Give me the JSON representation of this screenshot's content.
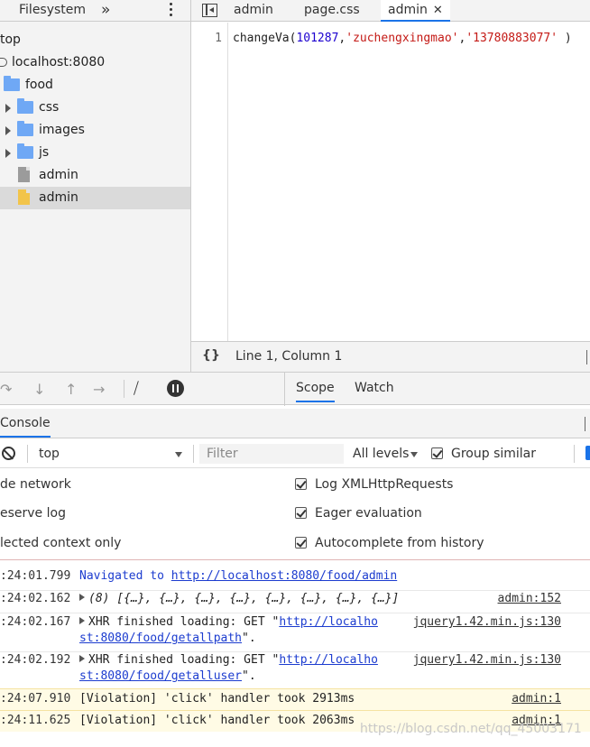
{
  "sidebar": {
    "tab_label": "Filesystem",
    "more_glyph": "»",
    "tree": [
      {
        "label": "top",
        "kind": "frame"
      },
      {
        "label": "localhost:8080",
        "kind": "origin"
      },
      {
        "label": "food",
        "kind": "folder"
      },
      {
        "label": "css",
        "kind": "folder"
      },
      {
        "label": "images",
        "kind": "folder"
      },
      {
        "label": "js",
        "kind": "folder"
      },
      {
        "label": "admin",
        "kind": "file-gray"
      },
      {
        "label": "admin",
        "kind": "file-yellow",
        "selected": true
      }
    ]
  },
  "editor": {
    "tabs": [
      {
        "label": "admin"
      },
      {
        "label": "page.css"
      },
      {
        "label": "admin",
        "active": true,
        "close": "✕"
      }
    ],
    "line_number": "1",
    "code": {
      "fn": "changeVa(",
      "num": "101287",
      "comma1": ",",
      "str1": "'zuchengxingmao'",
      "comma2": ",",
      "str2": "'13780883077'",
      "tail": " )"
    },
    "status": {
      "braces": "{}",
      "position": "Line 1, Column 1"
    }
  },
  "debugger": {
    "panel_tabs": [
      {
        "label": "Scope",
        "active": true
      },
      {
        "label": "Watch"
      }
    ]
  },
  "console": {
    "tab_label": "Console",
    "toolbar": {
      "context": "top",
      "filter_placeholder": "Filter",
      "levels": "All levels",
      "group_similar": "Group similar"
    },
    "settings": [
      {
        "label": "de network",
        "checked": false
      },
      {
        "label": "Log XMLHttpRequests",
        "checked": true
      },
      {
        "label": "eserve log",
        "checked": false
      },
      {
        "label": "Eager evaluation",
        "checked": true
      },
      {
        "label": "lected context only",
        "checked": false
      },
      {
        "label": "Autocomplete from history",
        "checked": true
      }
    ],
    "messages": [
      {
        "time": ":24:01.799",
        "text_prefix": "Navigated to ",
        "url": "http://localhost:8080/food/admin"
      },
      {
        "time": ":24:02.162",
        "text": "(8) [{…}, {…}, {…}, {…}, {…}, {…}, {…}, {…}]",
        "source": "admin:152"
      },
      {
        "time": ":24:02.167",
        "text_prefix": "XHR finished loading: GET \"",
        "url_a": "http://localho",
        "url_b": "st:8080/food/getallpath",
        "text_suffix": "\".",
        "source": "jquery1.42.min.js:130"
      },
      {
        "time": ":24:02.192",
        "text_prefix": "XHR finished loading: GET \"",
        "url_a": "http://localho",
        "url_b": "st:8080/food/getalluser",
        "text_suffix": "\".",
        "source": "jquery1.42.min.js:130"
      },
      {
        "time": ":24:07.910",
        "text": "[Violation] 'click' handler took 2913ms",
        "source": "admin:1"
      },
      {
        "time": ":24:11.625",
        "text": "[Violation] 'click' handler took 2063ms",
        "source": "admin:1"
      }
    ]
  },
  "watermark": "https://blog.csdn.net/qq_45003171"
}
